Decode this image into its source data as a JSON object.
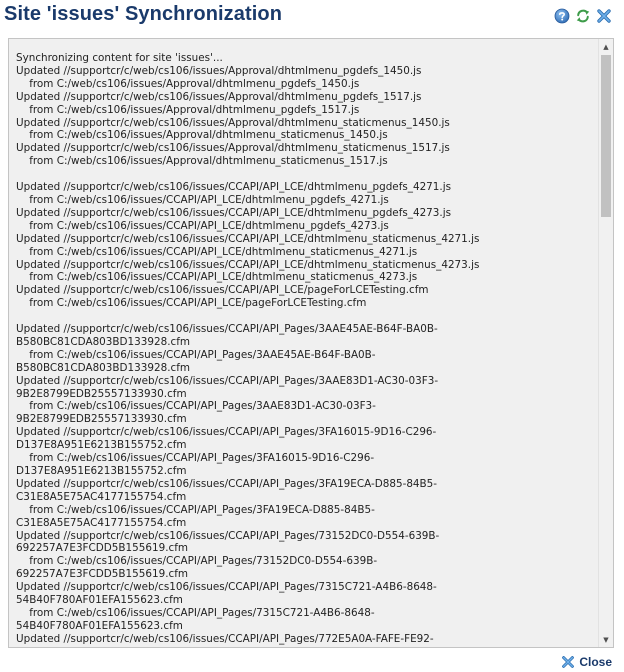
{
  "dialog": {
    "title": "Site 'issues' Synchronization",
    "icons": {
      "help": "help-icon",
      "refresh": "refresh-icon",
      "close": "close-icon"
    },
    "colors": {
      "title": "#1a3a6b",
      "panel_bg": "#f0f0f0",
      "help_blue": "#3f7fc4",
      "refresh_green": "#3e9c4a",
      "close_blue": "#4f8fce"
    }
  },
  "log": {
    "lines": [
      "Synchronizing content for site 'issues'...",
      "Updated //supportcr/c/web/cs106/issues/Approval/dhtmlmenu_pgdefs_1450.js",
      "    from C:/web/cs106/issues/Approval/dhtmlmenu_pgdefs_1450.js",
      "Updated //supportcr/c/web/cs106/issues/Approval/dhtmlmenu_pgdefs_1517.js",
      "    from C:/web/cs106/issues/Approval/dhtmlmenu_pgdefs_1517.js",
      "Updated //supportcr/c/web/cs106/issues/Approval/dhtmlmenu_staticmenus_1450.js",
      "    from C:/web/cs106/issues/Approval/dhtmlmenu_staticmenus_1450.js",
      "Updated //supportcr/c/web/cs106/issues/Approval/dhtmlmenu_staticmenus_1517.js",
      "    from C:/web/cs106/issues/Approval/dhtmlmenu_staticmenus_1517.js",
      "",
      "Updated //supportcr/c/web/cs106/issues/CCAPI/API_LCE/dhtmlmenu_pgdefs_4271.js",
      "    from C:/web/cs106/issues/CCAPI/API_LCE/dhtmlmenu_pgdefs_4271.js",
      "Updated //supportcr/c/web/cs106/issues/CCAPI/API_LCE/dhtmlmenu_pgdefs_4273.js",
      "    from C:/web/cs106/issues/CCAPI/API_LCE/dhtmlmenu_pgdefs_4273.js",
      "Updated //supportcr/c/web/cs106/issues/CCAPI/API_LCE/dhtmlmenu_staticmenus_4271.js",
      "    from C:/web/cs106/issues/CCAPI/API_LCE/dhtmlmenu_staticmenus_4271.js",
      "Updated //supportcr/c/web/cs106/issues/CCAPI/API_LCE/dhtmlmenu_staticmenus_4273.js",
      "    from C:/web/cs106/issues/CCAPI/API_LCE/dhtmlmenu_staticmenus_4273.js",
      "Updated //supportcr/c/web/cs106/issues/CCAPI/API_LCE/pageForLCETesting.cfm",
      "    from C:/web/cs106/issues/CCAPI/API_LCE/pageForLCETesting.cfm",
      "",
      "Updated //supportcr/c/web/cs106/issues/CCAPI/API_Pages/3AAE45AE-B64F-BA0B-",
      "B580BC81CDA803BD133928.cfm",
      "    from C:/web/cs106/issues/CCAPI/API_Pages/3AAE45AE-B64F-BA0B-",
      "B580BC81CDA803BD133928.cfm",
      "Updated //supportcr/c/web/cs106/issues/CCAPI/API_Pages/3AAE83D1-AC30-03F3-",
      "9B2E8799EDB25557133930.cfm",
      "    from C:/web/cs106/issues/CCAPI/API_Pages/3AAE83D1-AC30-03F3-",
      "9B2E8799EDB25557133930.cfm",
      "Updated //supportcr/c/web/cs106/issues/CCAPI/API_Pages/3FA16015-9D16-C296-",
      "D137E8A951E6213B155752.cfm",
      "    from C:/web/cs106/issues/CCAPI/API_Pages/3FA16015-9D16-C296-",
      "D137E8A951E6213B155752.cfm",
      "Updated //supportcr/c/web/cs106/issues/CCAPI/API_Pages/3FA19ECA-D885-84B5-",
      "C31E8A5E75AC4177155754.cfm",
      "    from C:/web/cs106/issues/CCAPI/API_Pages/3FA19ECA-D885-84B5-",
      "C31E8A5E75AC4177155754.cfm",
      "Updated //supportcr/c/web/cs106/issues/CCAPI/API_Pages/73152DC0-D554-639B-",
      "692257A7E3FCDD5B155619.cfm",
      "    from C:/web/cs106/issues/CCAPI/API_Pages/73152DC0-D554-639B-",
      "692257A7E3FCDD5B155619.cfm",
      "Updated //supportcr/c/web/cs106/issues/CCAPI/API_Pages/7315C721-A4B6-8648-",
      "54B40F780AF01EFA155623.cfm",
      "    from C:/web/cs106/issues/CCAPI/API_Pages/7315C721-A4B6-8648-",
      "54B40F780AF01EFA155623.cfm",
      "Updated //supportcr/c/web/cs106/issues/CCAPI/API_Pages/772E5A0A-FAFE-FE92-"
    ]
  },
  "footer": {
    "close_label": "Close",
    "close_icon": "close-icon"
  }
}
